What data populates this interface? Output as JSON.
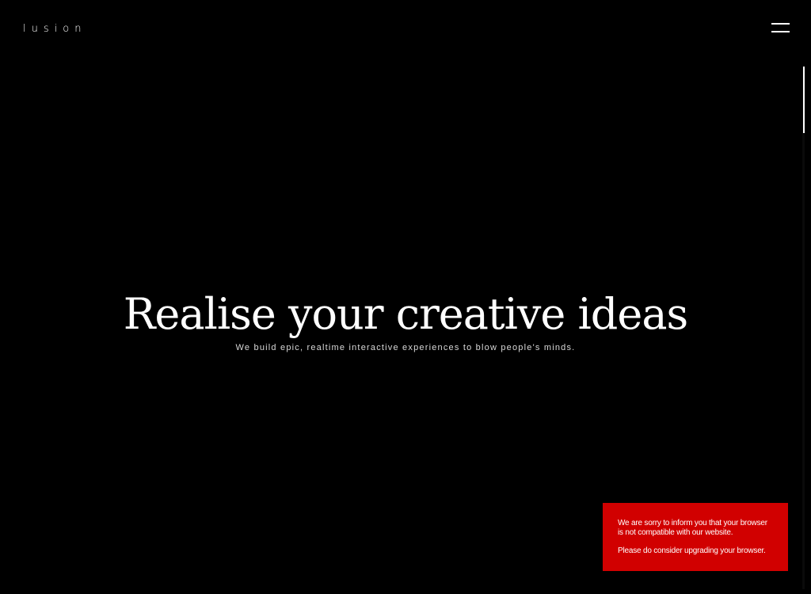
{
  "header": {
    "logo_text": "lusion",
    "menu_icon": "hamburger-menu-icon"
  },
  "hero": {
    "title": "Realise your creative ideas",
    "subtitle": "We build epic, realtime interactive experiences to blow people's minds."
  },
  "browser_warning": {
    "message": "We are sorry to inform you that your browser is not compatible with our website.",
    "advice": "Please do consider upgrading your browser.",
    "background_color": "#d10000"
  },
  "colors": {
    "background": "#000000",
    "text": "#ffffff",
    "warning": "#d10000"
  }
}
